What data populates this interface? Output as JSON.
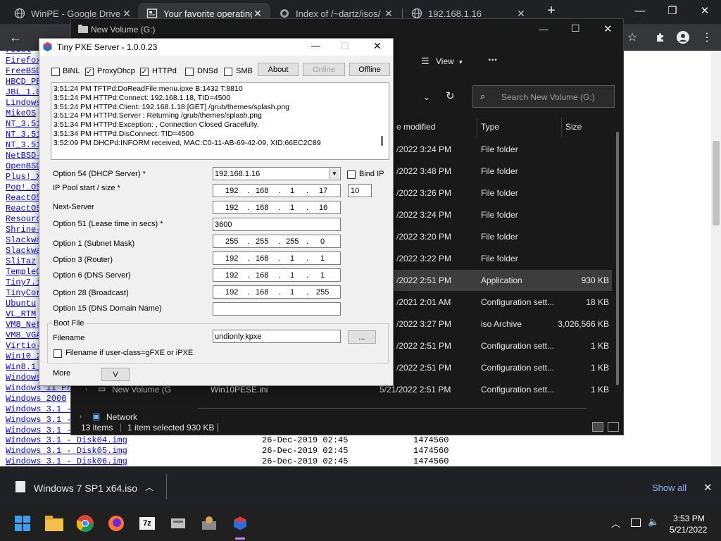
{
  "chrome": {
    "tabs": [
      {
        "title": "WinPE - Google Drive",
        "active": false
      },
      {
        "title": "Your favorite operating",
        "active": true
      },
      {
        "title": "Index of /~dartz/isos/",
        "active": false
      },
      {
        "title": "192.168.1.16",
        "active": false
      }
    ],
    "new_tab": "+"
  },
  "listing": {
    "left_names": [
      "reCol",
      "Firefox",
      "FreeBSD",
      "HBCD_PE",
      "JBL_1.0",
      "Lindows",
      "MikeOS",
      "NT_3.51",
      "NT_3.51",
      "NT_3.51",
      "NetBSD-",
      "OpenBSD",
      "Plus!_X",
      "Pop!_OS",
      "ReactOS",
      "ReactOS",
      "Resourc",
      "Shrine-",
      "Slackwa",
      "Slackwa",
      "SliTaz",
      "TempleO",
      "Tiny7.i",
      "TinyCor",
      "Ubuntu",
      "VL_RTM",
      "VM8_Net",
      "VM8_VGA",
      "Virtio-",
      "Win10_2",
      "Win8.1_",
      "Windows",
      "Windows 11 Pr",
      "Windows 2000",
      "Windows 3.1 -",
      "Windows 3.1 -",
      "Windows 3.1 -"
    ],
    "full_rows": [
      {
        "name": "Windows 3.1 - Disk04.img",
        "date": "26-Dec-2019 02:45",
        "size": "1474560"
      },
      {
        "name": "Windows 3.1 - Disk05.img",
        "date": "26-Dec-2019 02:45",
        "size": "1474560"
      },
      {
        "name": "Windows 3.1 - Disk06.img",
        "date": "26-Dec-2019 02:45",
        "size": "1474560"
      }
    ]
  },
  "explorer": {
    "title": "New Volume (G:)",
    "view_label": "View",
    "more_label": "...",
    "search_placeholder": "Search New Volume (G:)",
    "col_modified": "e modified",
    "col_type": "Type",
    "col_size": "Size",
    "rows": [
      {
        "modified": "/2022 3:24 PM",
        "type": "File folder",
        "size": ""
      },
      {
        "modified": "/2022 3:48 PM",
        "type": "File folder",
        "size": ""
      },
      {
        "modified": "/2022 3:26 PM",
        "type": "File folder",
        "size": ""
      },
      {
        "modified": "/2022 3:24 PM",
        "type": "File folder",
        "size": ""
      },
      {
        "modified": "/2022 3:20 PM",
        "type": "File folder",
        "size": ""
      },
      {
        "modified": "/2022 3:22 PM",
        "type": "File folder",
        "size": ""
      },
      {
        "modified": "/2022 2:51 PM",
        "type": "Application",
        "size": "930 KB"
      },
      {
        "modified": "/2021 2:01 AM",
        "type": "Configuration sett...",
        "size": "18 KB"
      },
      {
        "modified": "/2022 3:27 PM",
        "type": "iso Archive",
        "size": "3,026,566 KB"
      },
      {
        "modified": "/2022 2:51 PM",
        "type": "Configuration sett...",
        "size": "1 KB"
      },
      {
        "modified": "/2022 2:51 PM",
        "type": "Configuration sett...",
        "size": "1 KB"
      }
    ],
    "last_row": {
      "name": "Win10PESE.ini",
      "modified": "5/21/2022 2:51 PM",
      "type": "Configuration sett...",
      "size": "1 KB"
    },
    "nav_new_volume": "New Volume (G",
    "nav_network": "Network",
    "status_items": "13 items",
    "status_selected": "1 item selected  930 KB"
  },
  "pxe": {
    "title": "Tiny PXE Server - 1.0.0.23",
    "checks": [
      {
        "label": "BINL",
        "checked": false
      },
      {
        "label": "ProxyDhcp",
        "checked": true
      },
      {
        "label": "HTTPd",
        "checked": true
      },
      {
        "label": "DNSd",
        "checked": false
      },
      {
        "label": "SMB",
        "checked": false
      }
    ],
    "btn_about": "About",
    "btn_online": "Online",
    "btn_offline": "Offline",
    "log": [
      "3:51:24 PM TFTPd:DoReadFile:menu.ipxe B:1432 T:8810",
      "3:51:24 PM HTTPd:Connect: 192.168.1.18, TID=4500",
      "3:51:24 PM HTTPd:Client: 192.168.1.18 [GET] /grub/themes/splash.png",
      "3:51:24 PM HTTPd:Server : Returning /grub/themes/splash.png",
      "3:51:34 PM HTTPd:Exception: , Connection Closed Gracefully.",
      "3:51:34 PM HTTPd:DisConnect: TID=4500",
      "3:52:09 PM DHCPd:INFORM received, MAC:C0-11-AB-69-42-09, XID:66EC2C89"
    ],
    "opt54_label": "Option 54 (DHCP Server) *",
    "opt54_value": "192.168.1.16",
    "bindip_label": "Bind IP",
    "pool_label": "IP Pool start / size *",
    "pool_ip": [
      "192",
      "168",
      "1",
      "17"
    ],
    "pool_size": "10",
    "next_label": "Next-Server",
    "next_ip": [
      "192",
      "168",
      "1",
      "16"
    ],
    "opt51_label": "Option 51 (Lease time in secs) *",
    "opt51_value": "3600",
    "opt1_label": "Option 1  (Subnet Mask)",
    "opt1_ip": [
      "255",
      "255",
      "255",
      "0"
    ],
    "opt3_label": "Option 3  (Router)",
    "opt3_ip": [
      "192",
      "168",
      "1",
      "1"
    ],
    "opt6_label": "Option 6  (DNS Server)",
    "opt6_ip": [
      "192",
      "168",
      "1",
      "1"
    ],
    "opt28_label": "Option 28 (Broadcast)",
    "opt28_ip": [
      "192",
      "168",
      "1",
      "255"
    ],
    "opt15_label": "Option 15 (DNS Domain Name)",
    "opt15_value": "",
    "bootfile_group": "Boot File",
    "filename_label": "Filename",
    "filename_value": "undionly.kpxe",
    "browse_label": "...",
    "userclass_label": "Filename if user-class=gFXE or iPXE",
    "more_label": "More",
    "more_btn": "V"
  },
  "download": {
    "file": "Windows 7 SP1 x64.iso",
    "show_all": "Show all"
  },
  "taskbar": {
    "time": "3:53 PM",
    "date": "5/21/2022"
  },
  "colors": {
    "chrome_bg": "#202124",
    "explorer_bg": "#191919",
    "link": "#0000ee",
    "accent": "#8ab4f8"
  }
}
